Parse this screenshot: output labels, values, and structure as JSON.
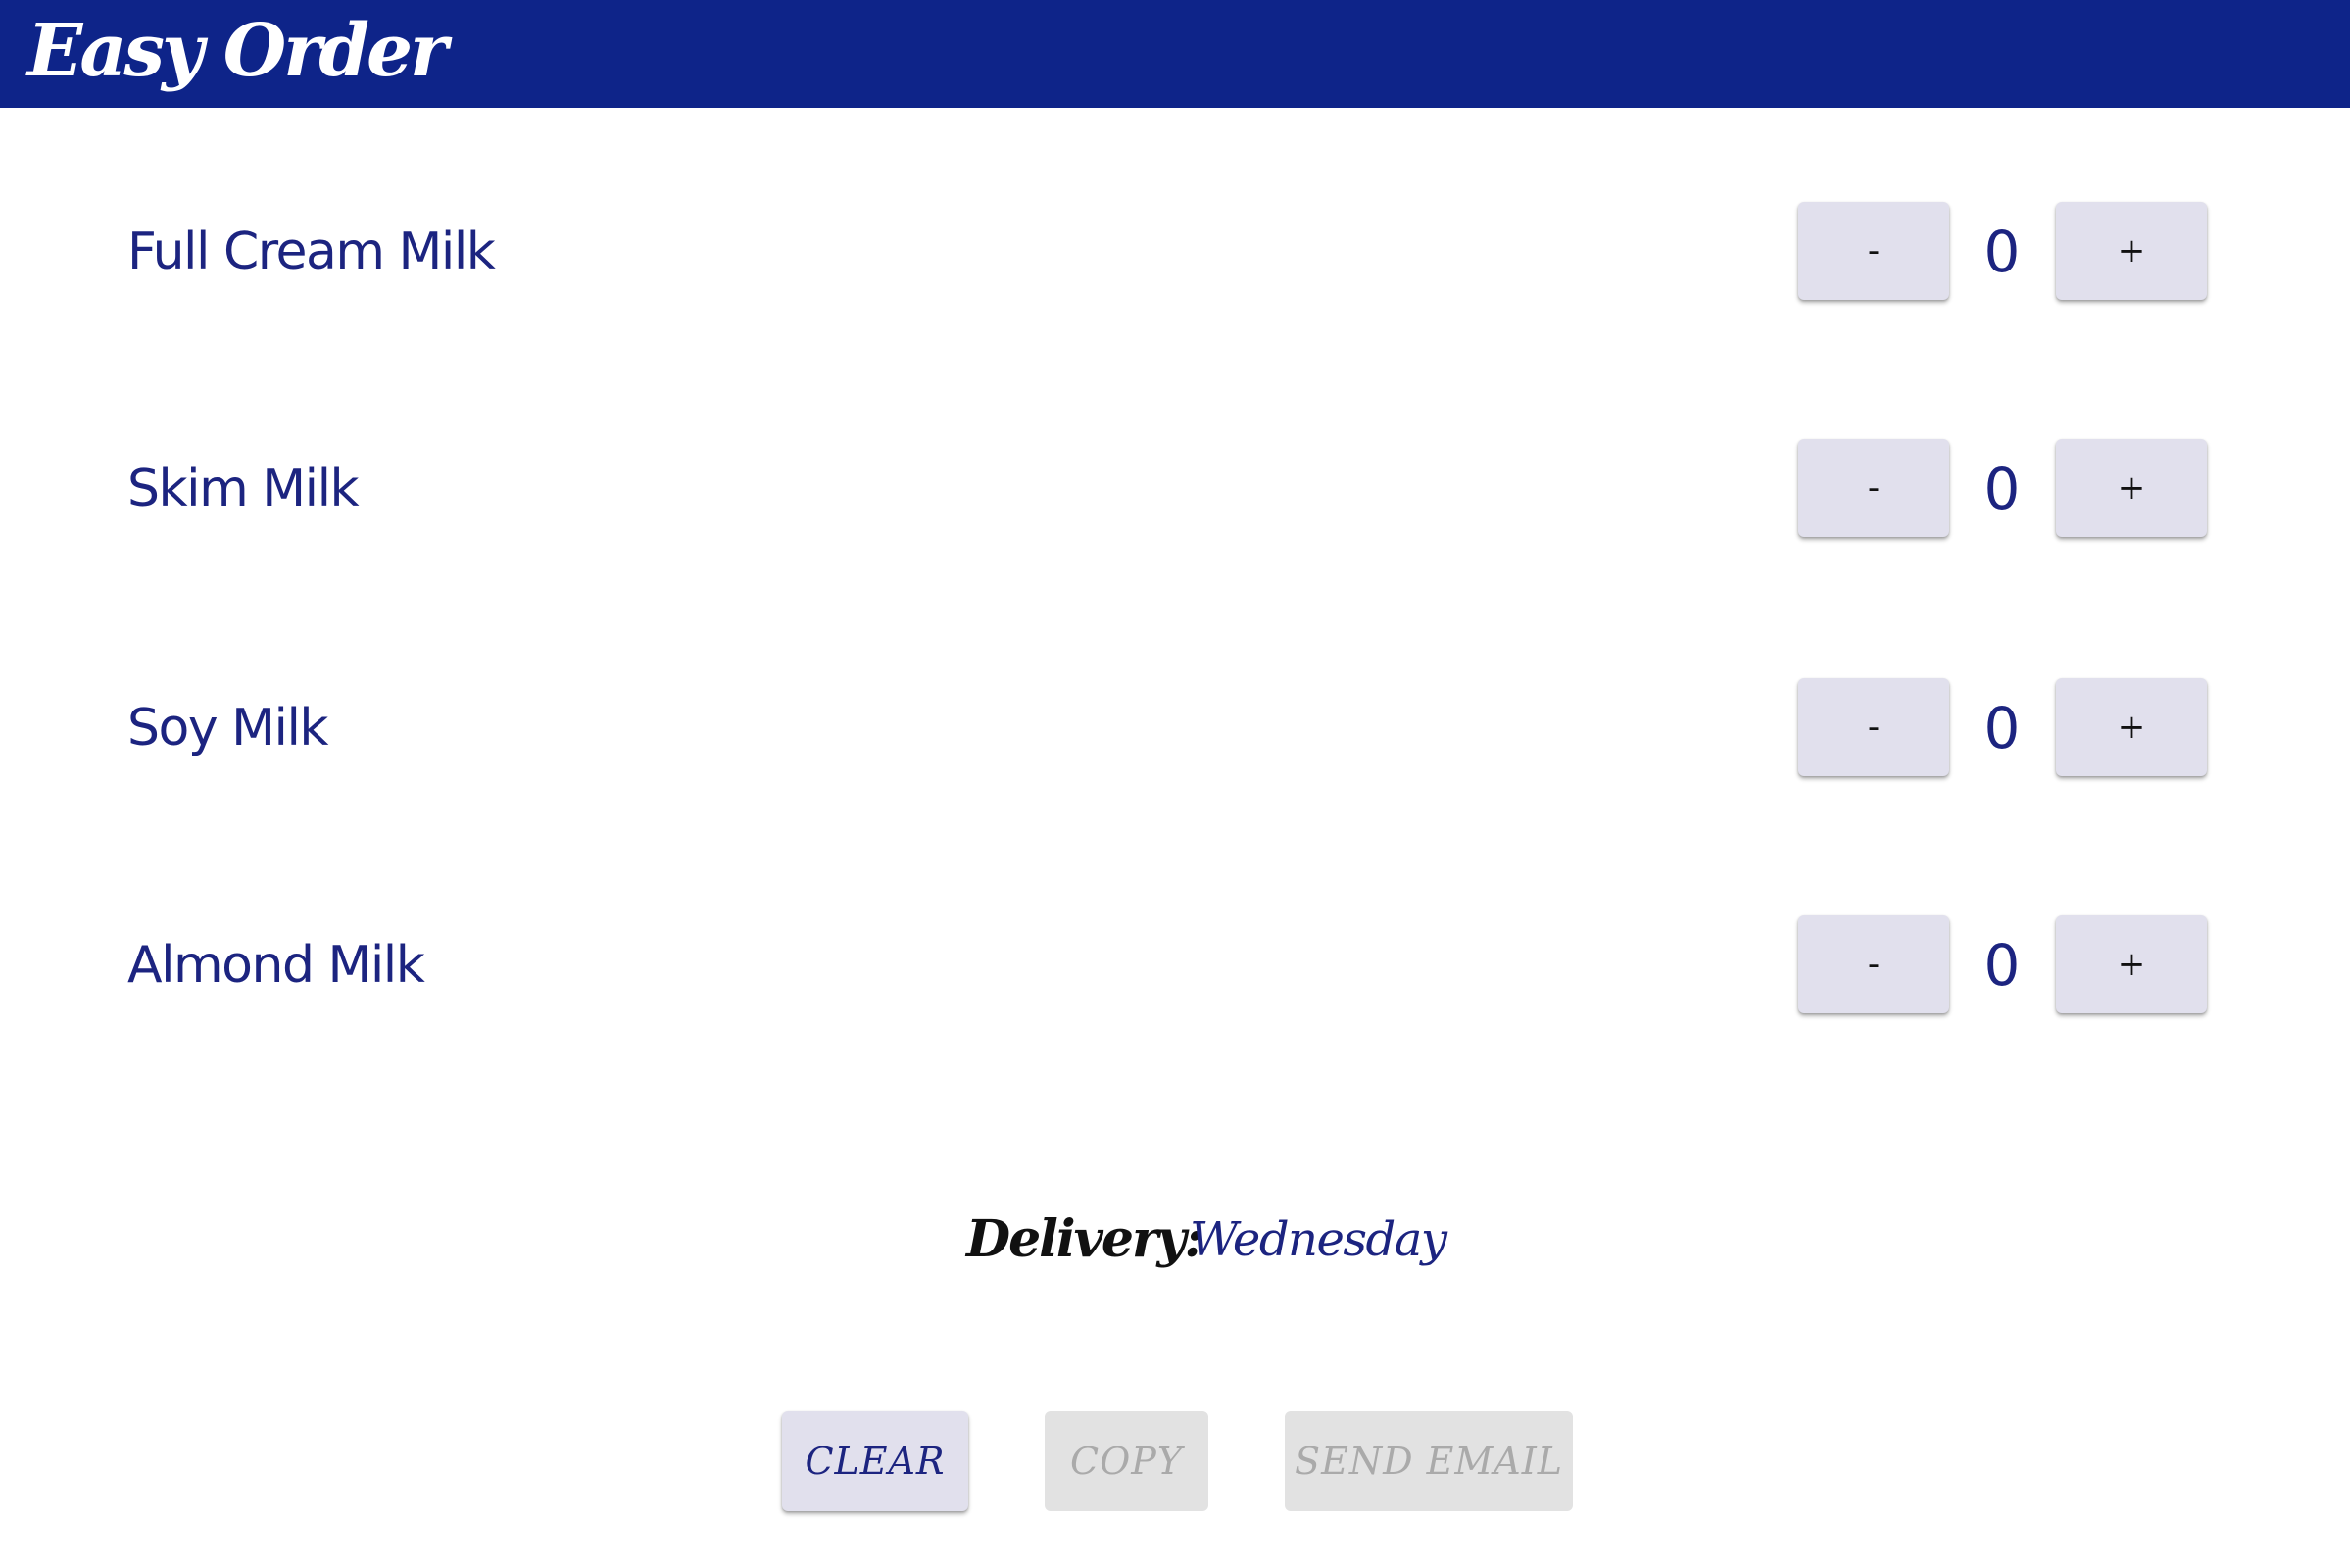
{
  "header": {
    "title": "Easy Order"
  },
  "products": [
    {
      "name": "Full Cream Milk",
      "quantity": "0",
      "minus_label": "-",
      "plus_label": "+"
    },
    {
      "name": "Skim Milk",
      "quantity": "0",
      "minus_label": "-",
      "plus_label": "+"
    },
    {
      "name": "Soy Milk",
      "quantity": "0",
      "minus_label": "-",
      "plus_label": "+"
    },
    {
      "name": "Almond Milk",
      "quantity": "0",
      "minus_label": "-",
      "plus_label": "+"
    }
  ],
  "delivery": {
    "label": "Delivery:",
    "day": "Wednesday"
  },
  "actions": {
    "clear_label": "CLEAR",
    "copy_label": "COPY",
    "send_email_label": "SEND EMAIL"
  },
  "colors": {
    "header_background": "#0e2489",
    "accent_text": "#1c2480",
    "button_background": "#e1e0ed",
    "disabled_button_background": "#e2e2e2",
    "disabled_button_text": "#aaaaaa"
  }
}
